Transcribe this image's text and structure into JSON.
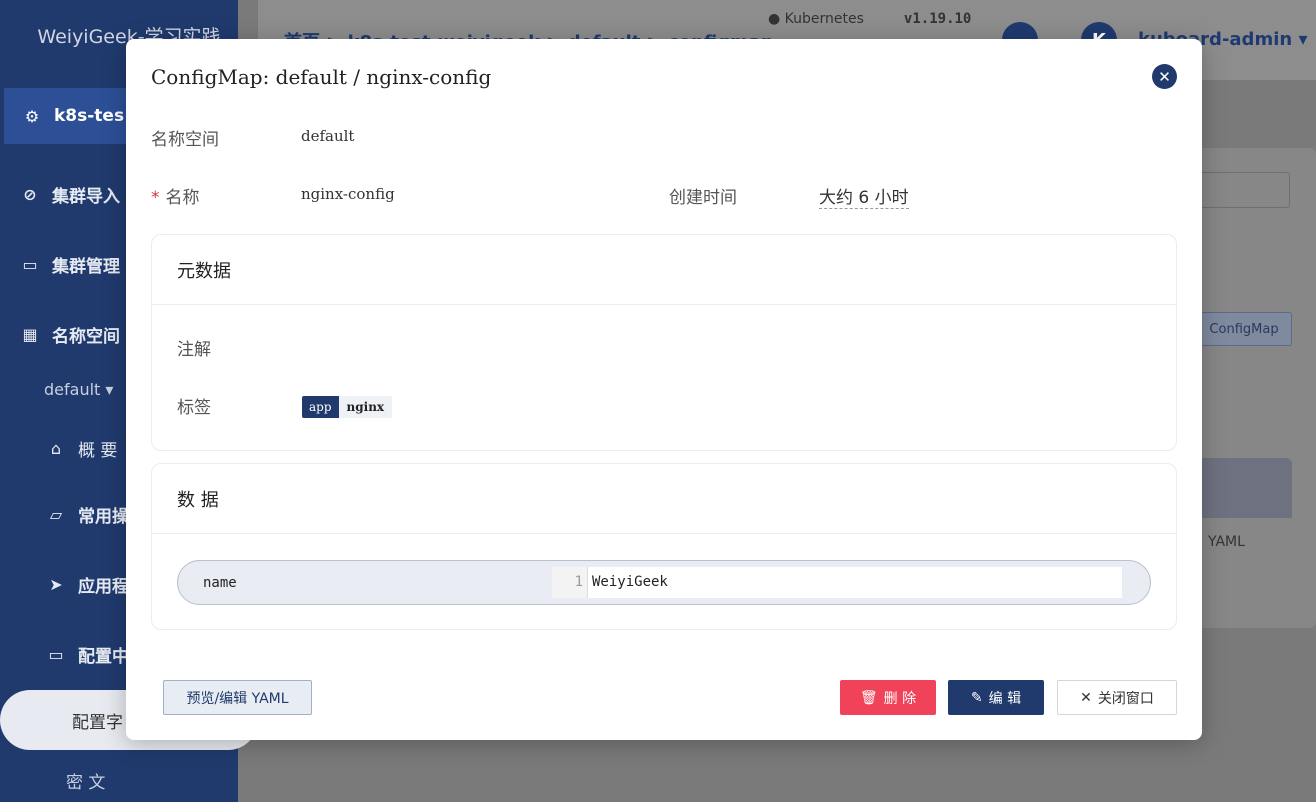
{
  "background": {
    "logo": "WeiyiGeek-学习实践",
    "cluster_name": "k8s-tes",
    "sidebar_items": [
      "集群导入",
      "集群管理",
      "名称空间"
    ],
    "namespace_selector": "default",
    "nav": [
      {
        "label": "概 要",
        "icon": "home-icon"
      },
      {
        "label": "常用操",
        "icon": "folder-icon"
      },
      {
        "label": "应用程",
        "icon": "send-icon"
      },
      {
        "label": "配置中",
        "icon": "stack-icon"
      }
    ],
    "active_sub": "配置字",
    "secret_sub": "密 文",
    "breadcrumb": "首页 > k8s-test-weiyigeek > default > configmap",
    "k8s_label": "Kubernetes",
    "k8s_version": "v1.19.10",
    "user_initial": "K",
    "user_name": "kuboard-admin",
    "bg_button": "ConfigMap",
    "bg_yaml": "YAML"
  },
  "modal": {
    "title": "ConfigMap: default / nginx-config",
    "namespace_label": "名称空间",
    "namespace_value": "default",
    "name_required_mark": "*",
    "name_label": "名称",
    "name_value": "nginx-config",
    "created_label": "创建时间",
    "created_value": "大约 6 小时",
    "metadata_title": "元数据",
    "annotations_label": "注解",
    "labels_label": "标签",
    "labels": [
      {
        "key": "app",
        "value": "nginx"
      }
    ],
    "data_title": "数 据",
    "data": [
      {
        "key": "name",
        "line": "1",
        "value": "WeiyiGeek"
      }
    ],
    "buttons": {
      "yaml": "预览/编辑 YAML",
      "delete": "删 除",
      "edit": "编 辑",
      "close": "关闭窗口"
    }
  },
  "colors": {
    "primary": "#203a6e",
    "danger": "#f0435a",
    "tag_key_bg": "#203a6e"
  }
}
